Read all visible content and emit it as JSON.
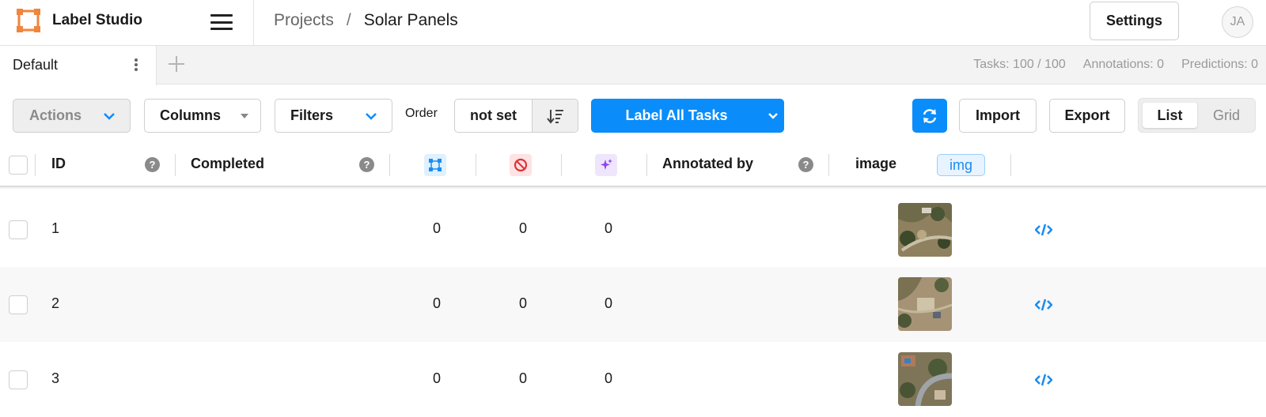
{
  "app": {
    "name": "Label Studio"
  },
  "breadcrumb": {
    "parent": "Projects",
    "separator": "/",
    "current": "Solar Panels"
  },
  "header": {
    "settings_label": "Settings",
    "avatar_initials": "JA"
  },
  "tabs": [
    {
      "label": "Default"
    }
  ],
  "stats": {
    "tasks": "Tasks: 100 / 100",
    "annotations": "Annotations: 0",
    "predictions": "Predictions: 0"
  },
  "toolbar": {
    "actions_label": "Actions",
    "columns_label": "Columns",
    "filters_label": "Filters",
    "order_label": "Order",
    "order_value": "not set",
    "label_all_label": "Label All Tasks",
    "import_label": "Import",
    "export_label": "Export",
    "view_list": "List",
    "view_grid": "Grid"
  },
  "table": {
    "columns": {
      "id": "ID",
      "completed": "Completed",
      "annotated_by": "Annotated by",
      "image": "image",
      "image_tag": "img"
    },
    "rows": [
      {
        "id": "1",
        "total_annotations": "0",
        "cancelled": "0",
        "predictions": "0"
      },
      {
        "id": "2",
        "total_annotations": "0",
        "cancelled": "0",
        "predictions": "0"
      },
      {
        "id": "3",
        "total_annotations": "0",
        "cancelled": "0",
        "predictions": "0"
      }
    ]
  },
  "colors": {
    "accent": "#0a8dfa",
    "row_alt": "#f8f8f8",
    "logo": "#f0853c"
  }
}
